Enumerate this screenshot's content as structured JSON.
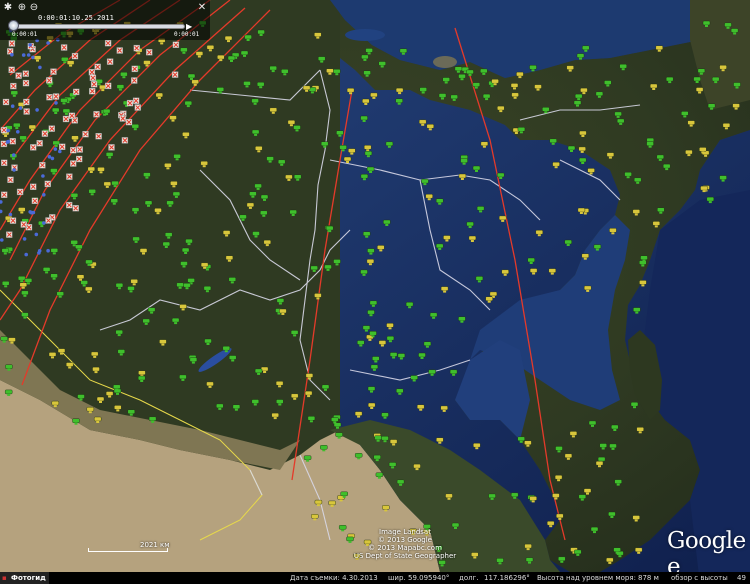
{
  "time_slider": {
    "current_time": "0:00:01:10.25.2011",
    "range_start": "0:00:01",
    "range_end": "0:00:01",
    "buttons": [
      "settings",
      "zoom-in",
      "zoom-out",
      "range"
    ]
  },
  "map": {
    "credits": [
      "Image Landsat",
      "© 2013 Google",
      "© 2013 Mapabc.com",
      "US Dept of State Geographer"
    ],
    "logo_text": "Google e",
    "scale_label": "2021 км",
    "colors": {
      "land_dark": "#2f3a22",
      "land_mid": "#4d5530",
      "desert": "#b5a27e",
      "sea": "#1d3a70",
      "ocean_deep": "#0f1f4c",
      "border_line": "#d8d8e8",
      "red_path": "#e43a2a",
      "yellow_outline": "#e7d94a",
      "green_icon": "#3fbf2c",
      "yellow_icon": "#d8c63c"
    }
  },
  "status_bar": {
    "tab_label": "Фотогид",
    "date_label": "Дата съемки: 4.30.2013",
    "lat_label": "шир.",
    "lat_value": "59.095940°",
    "lon_label": "долг.",
    "lon_value": "117.186296°",
    "elev_label": "Высота над уровнем моря:",
    "elev_value": "878 м",
    "alt_label": "обзор с высоты",
    "alt_value": "49"
  }
}
